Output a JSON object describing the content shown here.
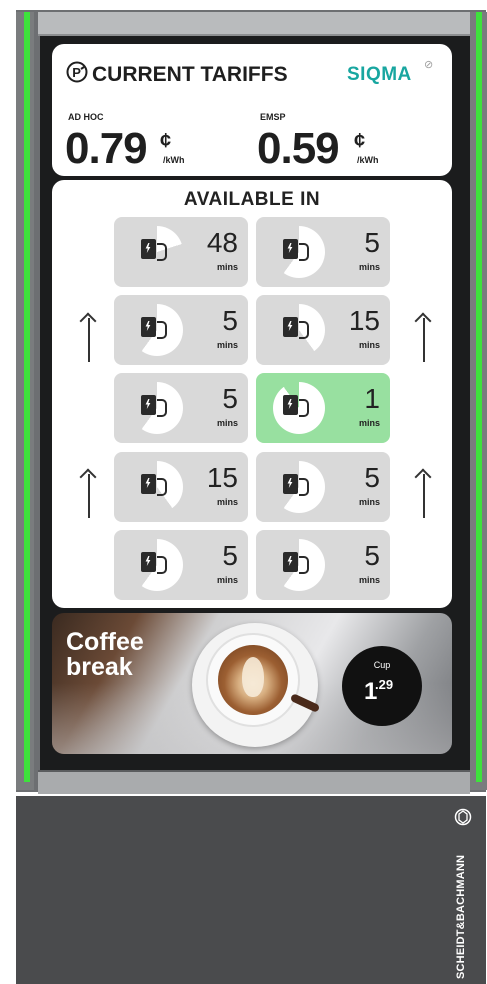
{
  "tariffs": {
    "title": "CURRENT TARIFFS",
    "brand": "SIQMA",
    "adhoc": {
      "label": "AD HOC",
      "price": "0.79",
      "currency": "¢",
      "unit": "/kWh"
    },
    "emsp": {
      "label": "EMSP",
      "price": "0.59",
      "currency": "¢",
      "unit": "/kWh"
    }
  },
  "availability": {
    "title": "AVAILABLE IN",
    "unit": "mins",
    "rows": [
      [
        {
          "value": "48",
          "fraction": 0.2
        },
        {
          "value": "5",
          "fraction": 0.6
        }
      ],
      [
        {
          "value": "5",
          "fraction": 0.6
        },
        {
          "value": "15",
          "fraction": 0.4
        }
      ],
      [
        {
          "value": "5",
          "fraction": 0.6
        },
        {
          "value": "1",
          "fraction": 0.9,
          "highlight": true
        }
      ],
      [
        {
          "value": "15",
          "fraction": 0.4
        },
        {
          "value": "5",
          "fraction": 0.6
        }
      ],
      [
        {
          "value": "5",
          "fraction": 0.6
        },
        {
          "value": "5",
          "fraction": 0.6
        }
      ]
    ]
  },
  "promo": {
    "title_line1": "Coffee",
    "title_line2": "break",
    "price_label": "Cup",
    "price_int": "1",
    "price_dec": ".29"
  },
  "vendor": {
    "name": "SCHEIDT&BACHMANN"
  },
  "colors": {
    "accent": "#18a6a0",
    "led": "#3ee23c",
    "highlight_tile": "#98e0a0",
    "tile": "#d9d9d9"
  }
}
